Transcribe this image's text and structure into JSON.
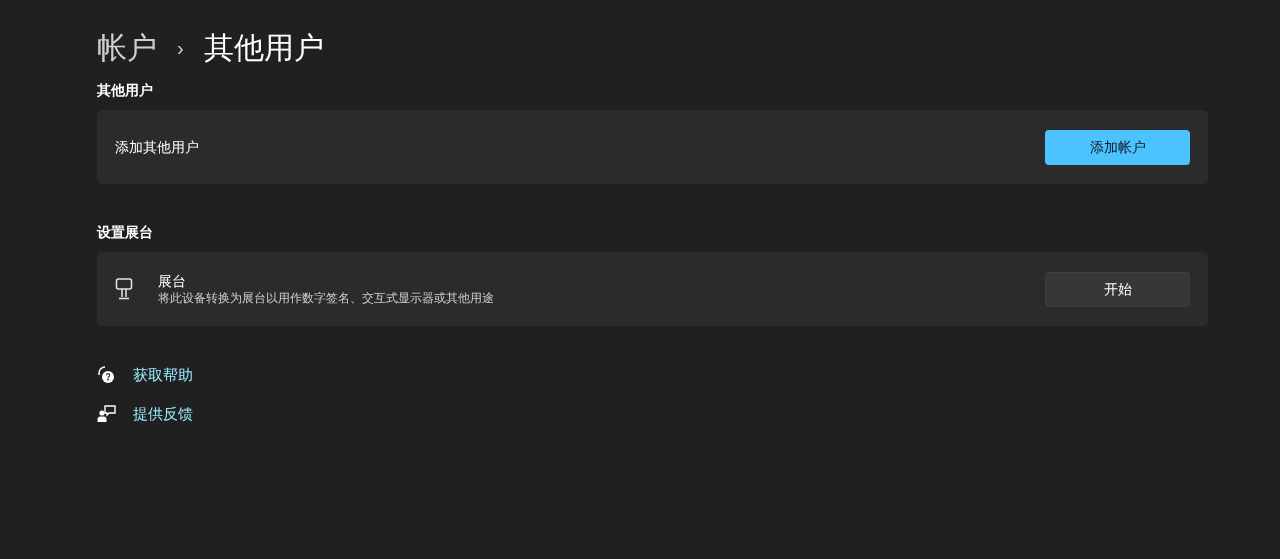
{
  "breadcrumb": {
    "parent": "帐户",
    "separator": "›",
    "current": "其他用户"
  },
  "sections": [
    {
      "heading": "其他用户",
      "card": {
        "title": "添加其他用户",
        "button": {
          "label": "添加帐户",
          "kind": "primary"
        }
      }
    },
    {
      "heading": "设置展台",
      "card": {
        "title": "展台",
        "description": "将此设备转换为展台以用作数字签名、交互式显示器或其他用途",
        "button": {
          "label": "开始",
          "kind": "secondary"
        }
      }
    }
  ],
  "links": [
    "获取帮助",
    "提供反馈"
  ]
}
